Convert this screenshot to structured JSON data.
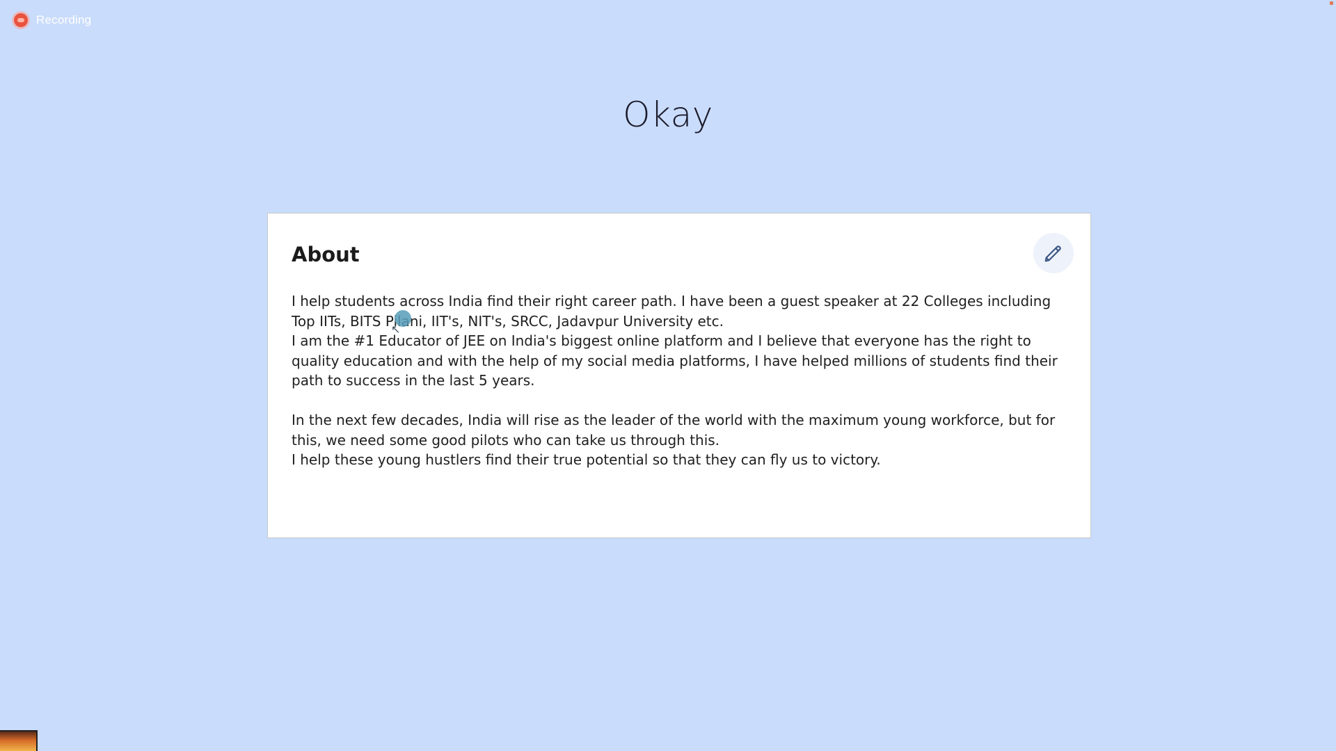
{
  "recording": {
    "label": "Recording"
  },
  "page": {
    "title": "Okay"
  },
  "about": {
    "heading": "About",
    "edit_icon": "pencil-icon",
    "paragraph1_line1": "I help students across India find their right career path. I have been a guest speaker at 22 Colleges including Top IITs, BITS Pilani, IIT's, NIT's, SRCC, Jadavpur University etc.",
    "paragraph1_line2": "I am the #1 Educator of JEE on India's biggest online platform and I believe that everyone has the right to quality education and with the help of my social media platforms, I have helped millions of students find their path to success in the last 5 years.",
    "paragraph2_line1": "In the next few decades, India will rise as the leader of the world with the maximum young workforce, but for this, we need some good pilots who can take us through this.",
    "paragraph2_line2": "I help these young hustlers find their true potential so that they can fly us to victory."
  },
  "colors": {
    "background": "#cadcfc",
    "card": "#ffffff",
    "recording_dot": "#e8523f",
    "edit_icon": "#3b5683"
  }
}
